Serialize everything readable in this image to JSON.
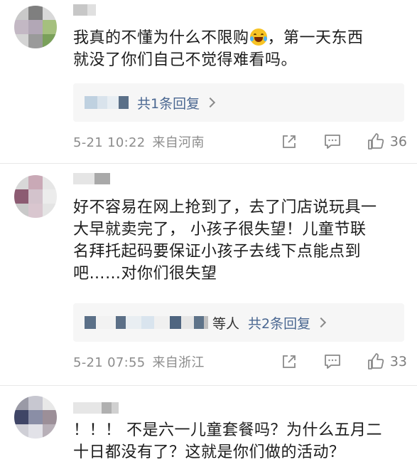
{
  "comments": [
    {
      "text_before": "我真的不懂为什么不限购",
      "emoji": "laughing-tears-emoji",
      "text_after": "，第一天东西\n就没了你们自己不觉得难看吗。",
      "reply_extra": "",
      "reply_link": "共1条回复",
      "time": "5-21 10:22",
      "location": "来自河南",
      "likes": "36"
    },
    {
      "text": "好不容易在网上抢到了，去了门店说玩具一\n大早就卖完了， 小孩子很失望！儿童节联\n名拜托起码要保证小孩子去线下点能点到\n吧……对你们很失望",
      "reply_extra": "等人",
      "reply_link": "共2条回复",
      "time": "5-21 07:55",
      "location": "来自浙江",
      "likes": "33"
    },
    {
      "text": "！！！ 不是六一儿童套餐吗？为什么五月二\n十日都没有了？这就是你们做的活动？"
    }
  ],
  "colors": {
    "link": "#4a6791",
    "meta": "#8c8c8c",
    "reply_bg": "#f6f6f6"
  },
  "icons": [
    "share-icon",
    "comment-icon",
    "thumbs-up-icon",
    "chevron-right-icon"
  ]
}
